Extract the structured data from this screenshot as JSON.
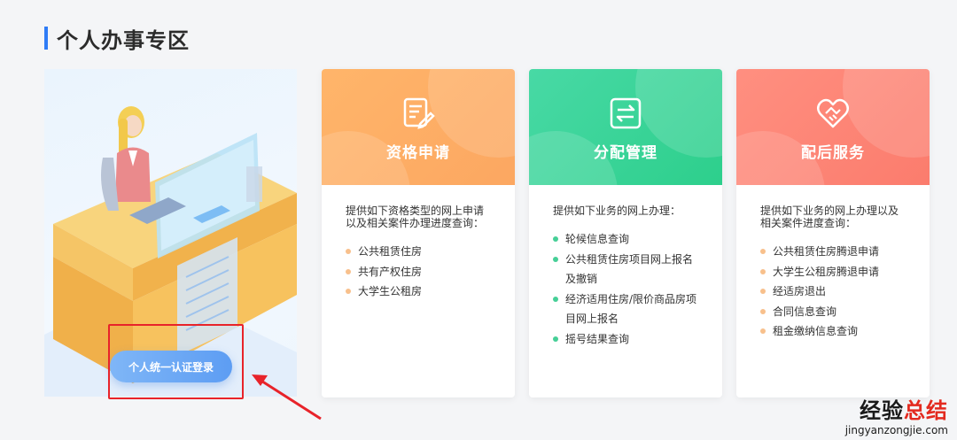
{
  "section": {
    "title": "个人办事专区"
  },
  "login": {
    "label": "个人统一认证登录"
  },
  "cards": [
    {
      "title": "资格申请",
      "icon": "document-edit-icon",
      "desc": "提供如下资格类型的网上申请以及相关案件办理进度查询：",
      "items": [
        "公共租赁住房",
        "共有产权住房",
        "大学生公租房"
      ]
    },
    {
      "title": "分配管理",
      "icon": "exchange-icon",
      "desc": "提供如下业务的网上办理：",
      "items": [
        "轮候信息查询",
        "公共租赁住房项目网上报名及撤销",
        "经济适用住房/限价商品房项目网上报名",
        "摇号结果查询"
      ]
    },
    {
      "title": "配后服务",
      "icon": "heart-handshake-icon",
      "desc": "提供如下业务的网上办理以及相关案件进度查询：",
      "items": [
        "公共租赁住房腾退申请",
        "大学生公租房腾退申请",
        "经适房退出",
        "合同信息查询",
        "租金缴纳信息查询"
      ]
    }
  ],
  "colors": {
    "accent": "#2f7cf6",
    "orange": "#fca761",
    "green": "#2dcf8c",
    "coral": "#fb7c6d",
    "highlight_red": "#e8232a"
  },
  "watermark": {
    "cn_a": "经验",
    "cn_b": "总结",
    "url": "jingyanzongjie.com"
  }
}
